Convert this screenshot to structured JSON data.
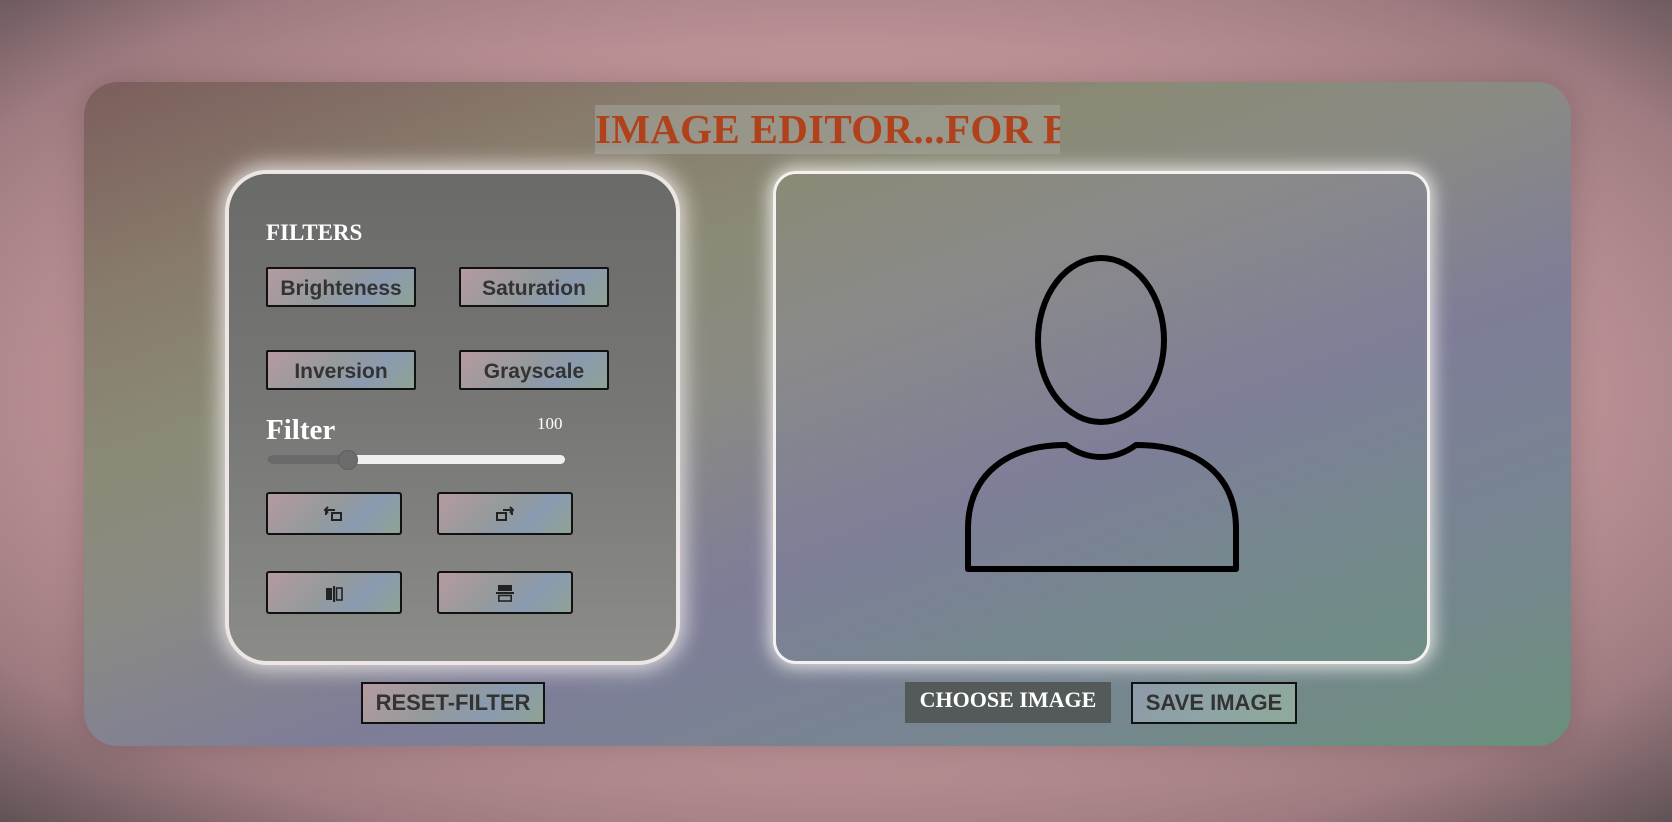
{
  "app": {
    "title": "IMAGE EDITOR...FOR B"
  },
  "filters": {
    "heading": "FILTERS",
    "buttons": [
      {
        "label": "Brighteness"
      },
      {
        "label": "Saturation"
      },
      {
        "label": "Inversion"
      },
      {
        "label": "Grayscale"
      }
    ],
    "active_filter_name": "Filter",
    "slider": {
      "value": "100",
      "fill_fraction": 0.27
    }
  },
  "transform": {
    "buttons": [
      {
        "icon": "rotate-left-icon"
      },
      {
        "icon": "rotate-right-icon"
      },
      {
        "icon": "flip-horizontal-icon"
      },
      {
        "icon": "flip-vertical-icon"
      }
    ]
  },
  "preview": {
    "icon": "user-placeholder-icon"
  },
  "actions": {
    "reset_label": "RESET-FILTER",
    "choose_label": "CHOOSE IMAGE",
    "save_label": "SAVE IMAGE"
  },
  "colors": {
    "title_text": "#b0411b",
    "title_bg": "#a0a096",
    "choose_bg": "#545a59"
  }
}
